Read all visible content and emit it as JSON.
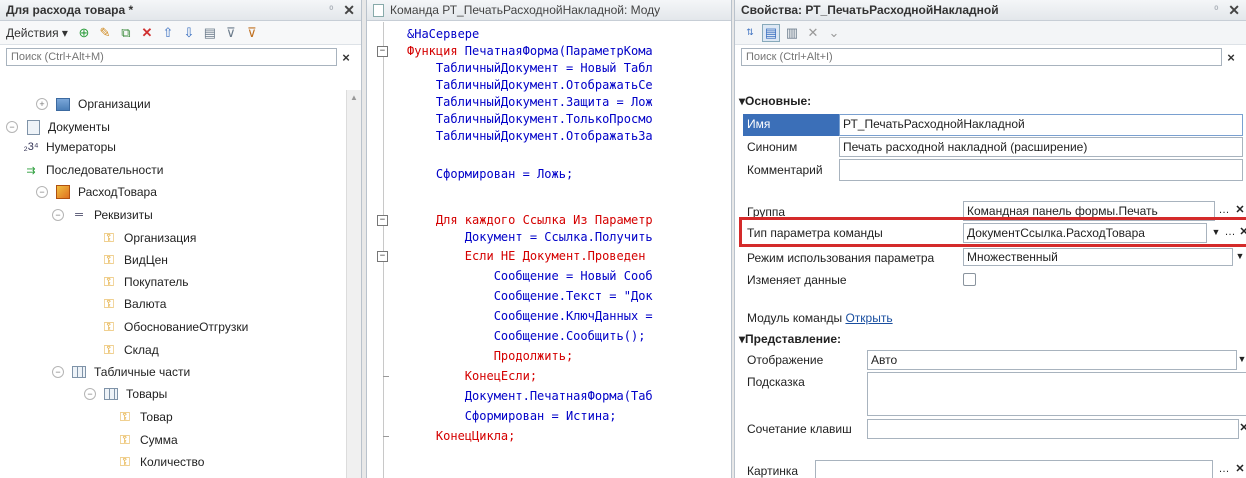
{
  "left": {
    "title": "Для расхода товара *",
    "pin": "⁰",
    "close": "✕",
    "actions_label": "Действия ▾",
    "search_placeholder": "Поиск (Ctrl+Alt+M)",
    "tree": [
      {
        "label": "Организации",
        "icon": "org-icon",
        "exp": "⊕"
      },
      {
        "label": "Документы",
        "icon": "doc-icon",
        "exp": "⊖"
      },
      {
        "label": "Нумераторы",
        "icon": "numerator-icon",
        "glyph": "₂3⁴"
      },
      {
        "label": "Последовательности",
        "icon": "sequence-icon",
        "glyph": "⇉"
      },
      {
        "label": "РасходТовара",
        "icon": "document-object-icon",
        "exp": "⊖"
      },
      {
        "label": "Реквизиты",
        "icon": "attributes-icon",
        "exp": "⊖",
        "glyph": "═"
      },
      {
        "label": "Организация",
        "icon": "key-icon"
      },
      {
        "label": "ВидЦен",
        "icon": "key-icon"
      },
      {
        "label": "Покупатель",
        "icon": "key-icon"
      },
      {
        "label": "Валюта",
        "icon": "key-icon"
      },
      {
        "label": "ОбоснованиеОтгрузки",
        "icon": "key-icon"
      },
      {
        "label": "Склад",
        "icon": "key-icon"
      },
      {
        "label": "Табличные части",
        "icon": "table-icon",
        "exp": "⊖"
      },
      {
        "label": "Товары",
        "icon": "table-icon",
        "exp": "⊖"
      },
      {
        "label": "Товар",
        "icon": "key-icon"
      },
      {
        "label": "Сумма",
        "icon": "key-icon"
      },
      {
        "label": "Количество",
        "icon": "key-icon"
      }
    ]
  },
  "mid": {
    "title": "Команда РТ_ПечатьРасходнойНакладной: Моду",
    "lines": [
      {
        "t": "&НаСервере",
        "c": "tx"
      },
      {
        "t": "Функция ПечатнаяФорма(ПараметрКома",
        "c": "kwfn"
      },
      {
        "t": "    ТабличныйДокумент = Новый Табл",
        "c": "tx"
      },
      {
        "t": "    ТабличныйДокумент.ОтображатьСе",
        "c": "tx"
      },
      {
        "t": "    ТабличныйДокумент.Защита = Лож",
        "c": "tx"
      },
      {
        "t": "    ТабличныйДокумент.ТолькоПросмо",
        "c": "tx"
      },
      {
        "t": "    ТабличныйДокумент.ОтображатьЗа",
        "c": "tx"
      },
      {
        "t": "",
        "c": "tx"
      },
      {
        "t": "    Сформирован = Ложь;",
        "c": "tx"
      },
      {
        "t": "",
        "c": "tx"
      },
      {
        "t": "    Для каждого Ссылка Из Параметр",
        "c": "kw"
      },
      {
        "t": "        Документ = Ссылка.Получить",
        "c": "tx"
      },
      {
        "t": "        Если НЕ Документ.Проведен ",
        "c": "kw"
      },
      {
        "t": "            Сообщение = Новый Сооб",
        "c": "tx"
      },
      {
        "t": "            Сообщение.Текст = \"Док",
        "c": "tx"
      },
      {
        "t": "            Сообщение.КлючДанных = ",
        "c": "tx"
      },
      {
        "t": "            Сообщение.Сообщить();",
        "c": "tx"
      },
      {
        "t": "            Продолжить;",
        "c": "kw"
      },
      {
        "t": "        КонецЕсли;",
        "c": "kw"
      },
      {
        "t": "        Документ.ПечатнаяФорма(Таб",
        "c": "tx"
      },
      {
        "t": "        Сформирован = Истина;",
        "c": "tx"
      },
      {
        "t": "    КонецЦикла;",
        "c": "kw"
      }
    ]
  },
  "right": {
    "title": "Свойства: РТ_ПечатьРасходнойНакладной",
    "pin": "⁰",
    "close": "✕",
    "search_placeholder": "Поиск (Ctrl+Alt+I)",
    "sec_main": "▾Основные:",
    "name_label": "Имя",
    "name_value": "РТ_ПечатьРасходнойНакладной",
    "synonym_label": "Синоним",
    "synonym_value": "Печать расходной накладной (расширение)",
    "comment_label": "Комментарий",
    "group_label": "Группа",
    "group_value": "Командная панель формы.Печать",
    "param_type_label": "Тип параметра команды",
    "param_type_value": "ДокументСсылка.РасходТовара",
    "param_mode_label": "Режим использования параметра",
    "param_mode_value": "Множественный",
    "changes_data_label": "Изменяет данные",
    "module_label": "Модуль команды",
    "module_link": "Открыть",
    "sec_view": "▾Представление:",
    "display_label": "Отображение",
    "display_value": "Авто",
    "hint_label": "Подсказка",
    "shortcut_label": "Сочетание клавиш",
    "picture_label": "Картинка"
  },
  "colors": {
    "accent": "#3b6fb8",
    "highlight": "#d42a2a",
    "keyword": "#d40000",
    "code": "#0000c8"
  }
}
